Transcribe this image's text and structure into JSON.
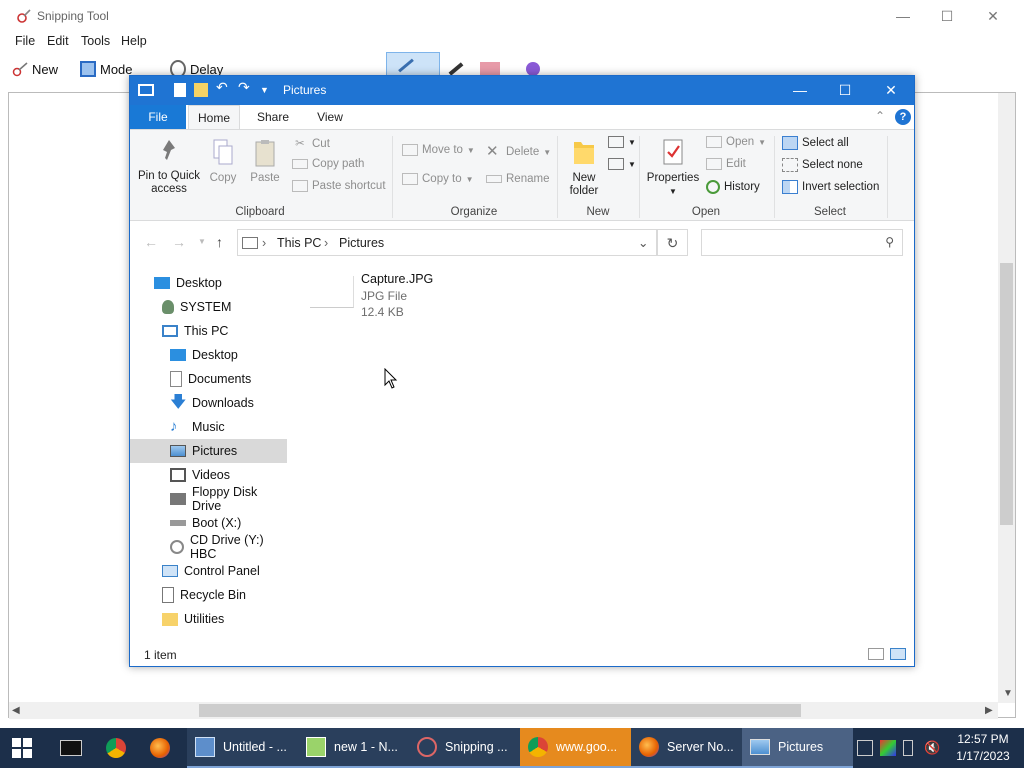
{
  "snipping_tool": {
    "title": "Snipping Tool",
    "menu": [
      "File",
      "Edit",
      "Tools",
      "Help"
    ],
    "toolbar": {
      "new": "New",
      "mode": "Mode",
      "delay": "Delay"
    }
  },
  "explorer": {
    "title": "Pictures",
    "tabs": {
      "file": "File",
      "home": "Home",
      "share": "Share",
      "view": "View"
    },
    "ribbon": {
      "clipboard": {
        "label": "Clipboard",
        "pin": "Pin to Quick access",
        "copy": "Copy",
        "paste": "Paste",
        "cut": "Cut",
        "copy_path": "Copy path",
        "paste_shortcut": "Paste shortcut"
      },
      "organize": {
        "label": "Organize",
        "move_to": "Move to",
        "copy_to": "Copy to",
        "delete": "Delete",
        "rename": "Rename"
      },
      "new": {
        "label": "New",
        "new_folder": "New folder"
      },
      "open": {
        "label": "Open",
        "properties": "Properties",
        "open": "Open",
        "edit": "Edit",
        "history": "History"
      },
      "select": {
        "label": "Select",
        "select_all": "Select all",
        "select_none": "Select none",
        "invert_selection": "Invert selection"
      }
    },
    "address": {
      "crumb1": "This PC",
      "crumb2": "Pictures",
      "search_placeholder": ""
    },
    "nav": [
      {
        "label": "Desktop"
      },
      {
        "label": "SYSTEM"
      },
      {
        "label": "This PC"
      },
      {
        "label": "Desktop"
      },
      {
        "label": "Documents"
      },
      {
        "label": "Downloads"
      },
      {
        "label": "Music"
      },
      {
        "label": "Pictures"
      },
      {
        "label": "Videos"
      },
      {
        "label": "Floppy Disk Drive"
      },
      {
        "label": "Boot (X:)"
      },
      {
        "label": "CD Drive (Y:) HBC"
      },
      {
        "label": "Control Panel"
      },
      {
        "label": "Recycle Bin"
      },
      {
        "label": "Utilities"
      }
    ],
    "file": {
      "name": "Capture.JPG",
      "type": "JPG File",
      "size": "12.4 KB"
    },
    "status": "1 item"
  },
  "taskbar": {
    "apps": [
      {
        "label": "Untitled - ..."
      },
      {
        "label": "new 1 - N..."
      },
      {
        "label": "Snipping ..."
      },
      {
        "label": "www.goo..."
      },
      {
        "label": "Server No..."
      },
      {
        "label": "Pictures"
      }
    ],
    "time": "12:57 PM",
    "date": "1/17/2023"
  },
  "colors": {
    "accent": "#1f74d3",
    "taskbar": "#1c2f4a",
    "chrome_highlight": "#e68a1e"
  }
}
